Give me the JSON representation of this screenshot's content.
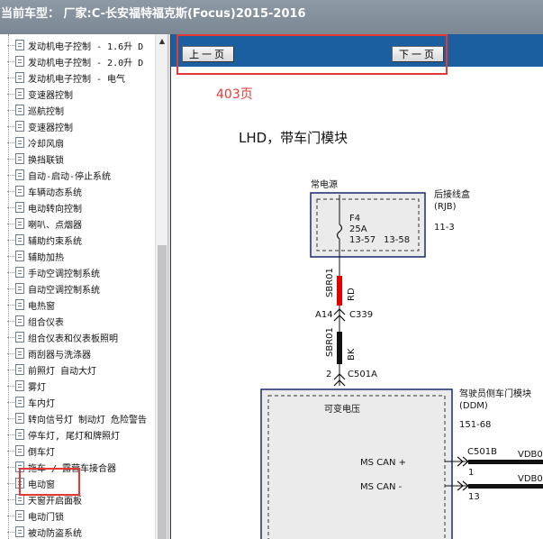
{
  "window": {
    "title": "当前车型：  厂家:C-长安福特福克斯(Focus)2015-2016"
  },
  "tree": {
    "items": [
      "发动机电子控制 - 1.6升 D",
      "发动机电子控制 - 2.0升 D",
      "发动机电子控制 - 电气",
      "变速器控制",
      "巡航控制",
      "变速器控制",
      "冷却风扇",
      "换挡联锁",
      "自动-启动-停止系统",
      "车辆动态系统",
      "电动转向控制",
      "喇叭、点烟器",
      "辅助约束系统",
      "辅助加热",
      "手动空调控制系统",
      "自动空调控制系统",
      "电热窗",
      "组合仪表",
      "组合仪表和仪表板照明",
      "雨刮器与洗涤器",
      "前照灯 自动大灯",
      "雾灯",
      "车内灯",
      "转向信号灯 制动灯 危险警告",
      "停车灯, 尾灯和牌照灯",
      "倒车灯",
      "拖车 / 露营车接合器",
      "电动窗",
      "天窗开启面板",
      "电动门锁",
      "被动防盗系统"
    ],
    "selected_index": 27
  },
  "nav": {
    "prev_label": "上一页",
    "next_label": "下一页"
  },
  "page": {
    "number": "403页",
    "title": "LHD，带车门模块"
  },
  "diagram": {
    "constant_power": "常电源",
    "fuse_name": "F4",
    "fuse_rating": "25A",
    "fuse_pin_a": "13-57",
    "fuse_pin_b": "13-58",
    "rjb_name": "后接线盒",
    "rjb_code": "(RJB)",
    "rjb_page": "11-3",
    "wire1_id": "SBR01",
    "wire1_color": "RD",
    "conn1_pin": "A14",
    "conn1_name": "C339",
    "wire2_id": "SBR01",
    "wire2_color": "BK",
    "conn2_pin": "2",
    "conn2_name": "C501A",
    "ddm_name": "驾驶员侧车门模块",
    "ddm_code": "(DDM)",
    "ddm_page": "151-68",
    "variable_voltage": "可变电压",
    "can_plus": "MS CAN +",
    "can_minus": "MS CAN -",
    "conn3_name": "C501B",
    "conn3_pin1": "1",
    "conn3_pin2": "13",
    "wire3_id": "VDB0",
    "wire4_id": "VDB0"
  },
  "colors": {
    "nav_bar": "#1c5fa0",
    "highlight_box": "#e53935",
    "wire_red": "#e00000",
    "wire_black": "#111111"
  }
}
